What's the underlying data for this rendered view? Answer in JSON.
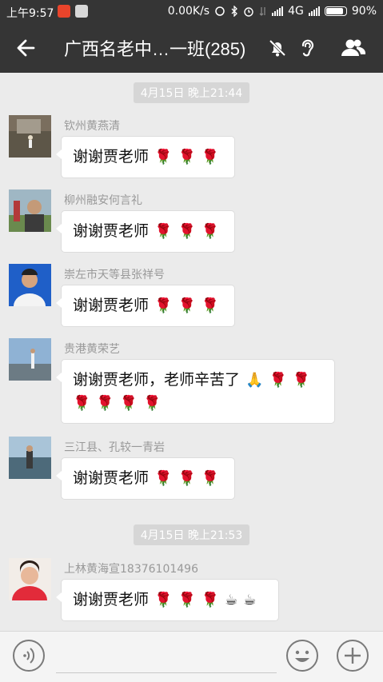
{
  "status_bar": {
    "time": "上午9:57",
    "net_speed": "0.00K/s",
    "network": "4G",
    "battery": "90%",
    "battery_level": 0.9
  },
  "header": {
    "title": "广西名老中…一班(285)"
  },
  "messages": [
    {
      "type": "timestamp",
      "text": "4月15日 晚上21:44"
    },
    {
      "type": "message",
      "sender": "钦州黄燕清",
      "text": "谢谢贾老师",
      "emoji": [
        "🌹",
        "🌹",
        "🌹"
      ]
    },
    {
      "type": "message",
      "sender": "柳州融安何言礼",
      "text": "谢谢贾老师",
      "emoji": [
        "🌹",
        "🌹",
        "🌹"
      ]
    },
    {
      "type": "message",
      "sender": "崇左市天等县张祥号",
      "text": "谢谢贾老师",
      "emoji": [
        "🌹",
        "🌹",
        "🌹"
      ]
    },
    {
      "type": "message",
      "sender": "贵港黄荣艺",
      "text": "谢谢贾老师，老师辛苦了",
      "emoji": [
        "🙏",
        "🌹",
        "🌹",
        "🌹",
        "🌹",
        "🌹",
        "🌹"
      ]
    },
    {
      "type": "message",
      "sender": "三江县、孔较一青岩",
      "text": "谢谢贾老师",
      "emoji": [
        "🌹",
        "🌹",
        "🌹"
      ]
    },
    {
      "type": "timestamp",
      "text": "4月15日 晚上21:53"
    },
    {
      "type": "message",
      "sender": "上林黄海宣18376101496",
      "text": "谢谢贾老师",
      "emoji": [
        "🌹",
        "🌹",
        "🌹",
        "☕",
        "☕"
      ]
    }
  ],
  "icons": {
    "back": "arrow-left-icon",
    "mute": "bell-off-icon",
    "earpiece": "ear-icon",
    "members": "group-icon",
    "voice": "voice-icon",
    "emoji": "smiley-icon",
    "more": "plus-icon"
  }
}
